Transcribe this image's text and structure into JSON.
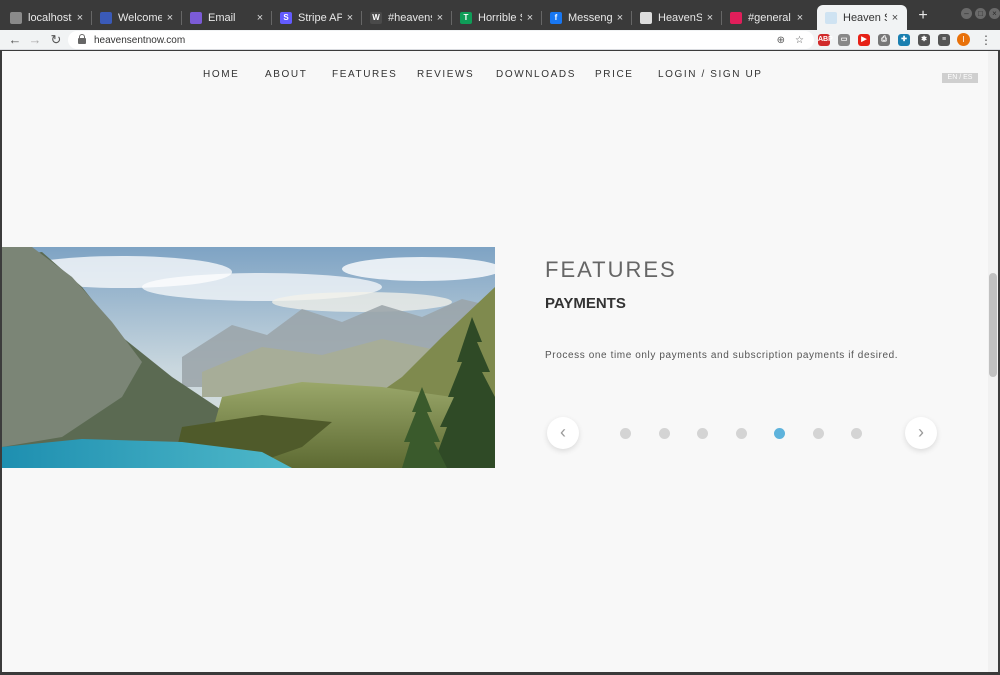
{
  "browser": {
    "tabs": [
      {
        "title": "localhost",
        "icon": "page-icon",
        "color": "#8a8a8a",
        "glyph": "",
        "active": false
      },
      {
        "title": "Welcome to",
        "icon": "globe-icon",
        "color": "#3a5ab8",
        "glyph": "",
        "active": false
      },
      {
        "title": "Email",
        "icon": "email-app-icon",
        "color": "#7b5bd6",
        "glyph": "",
        "active": false
      },
      {
        "title": "Stripe API R",
        "icon": "stripe-icon",
        "color": "#635bff",
        "glyph": "S",
        "active": false
      },
      {
        "title": "#heavensen",
        "icon": "webflow-icon",
        "color": "#4a4a4a",
        "glyph": "W",
        "active": false
      },
      {
        "title": "Horrible Su",
        "icon": "sheets-icon",
        "color": "#0f9d58",
        "glyph": "T",
        "active": false
      },
      {
        "title": "Messenger",
        "icon": "facebook-icon",
        "color": "#1877f2",
        "glyph": "f",
        "active": false
      },
      {
        "title": "HeavenSent",
        "icon": "page-icon",
        "color": "#dddddd",
        "glyph": "",
        "active": false
      },
      {
        "title": "#general",
        "icon": "slack-icon",
        "color": "#e01e5a",
        "glyph": "",
        "active": false
      },
      {
        "title": "Heaven Sen",
        "icon": "page-icon",
        "color": "#cfe3f2",
        "glyph": "",
        "active": true
      }
    ],
    "new_tab": "+",
    "window_buttons": [
      "–",
      "□",
      "×"
    ],
    "close_glyph": "×",
    "url": "heavensentnow.com",
    "back": "←",
    "forward": "→",
    "reload": "↻",
    "bookmark": "☆",
    "install": "⊕",
    "profile_initial": "I",
    "menu": "⋮",
    "extensions": [
      {
        "name": "adblock-icon",
        "color": "#d12a2a",
        "glyph": "ABP"
      },
      {
        "name": "extension-badge-icon",
        "color": "#888888",
        "glyph": "▭"
      },
      {
        "name": "youtube-icon",
        "color": "#e62117",
        "glyph": "▶"
      },
      {
        "name": "printer-icon",
        "color": "#777777",
        "glyph": "⎙"
      },
      {
        "name": "shield-extension-icon",
        "color": "#1a7fb0",
        "glyph": "✚"
      },
      {
        "name": "puzzle-icon",
        "color": "#555555",
        "glyph": "✱"
      },
      {
        "name": "playlist-icon",
        "color": "#555555",
        "glyph": "≡"
      }
    ]
  },
  "nav": {
    "items": [
      "HOME",
      "ABOUT",
      "FEATURES",
      "REVIEWS",
      "DOWNLOADS",
      "PRICE",
      "LOGIN / SIGN UP"
    ],
    "language": "EN / ES"
  },
  "features": {
    "heading": "FEATURES",
    "subheading": "PAYMENTS",
    "description": "Process one time only payments and subscription payments if desired.",
    "prev": "‹",
    "next": "›",
    "slide_count": 7,
    "active_slide": 5
  },
  "colors": {
    "accent_dot": "#5eb3dc",
    "inactive_dot": "#d4d4d4"
  }
}
